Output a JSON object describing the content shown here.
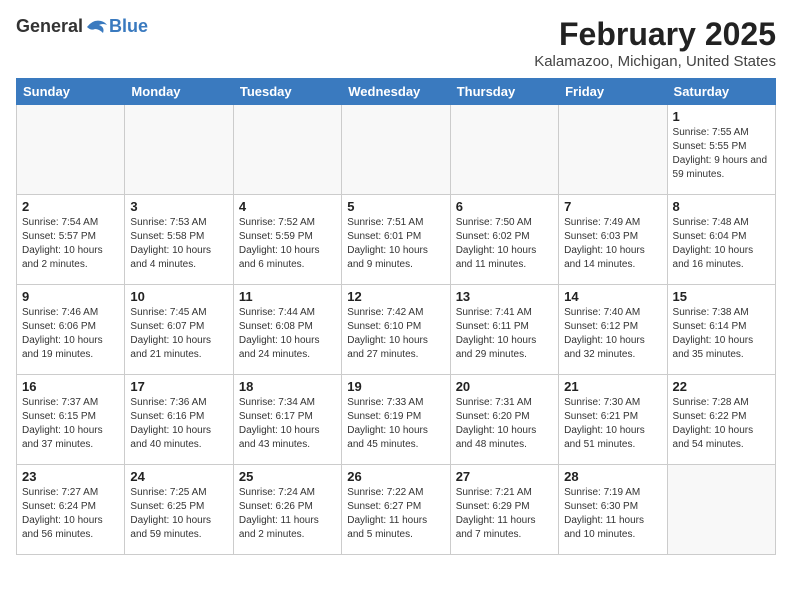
{
  "header": {
    "logo_general": "General",
    "logo_blue": "Blue",
    "title": "February 2025",
    "subtitle": "Kalamazoo, Michigan, United States"
  },
  "weekdays": [
    "Sunday",
    "Monday",
    "Tuesday",
    "Wednesday",
    "Thursday",
    "Friday",
    "Saturday"
  ],
  "weeks": [
    [
      {
        "day": "",
        "info": ""
      },
      {
        "day": "",
        "info": ""
      },
      {
        "day": "",
        "info": ""
      },
      {
        "day": "",
        "info": ""
      },
      {
        "day": "",
        "info": ""
      },
      {
        "day": "",
        "info": ""
      },
      {
        "day": "1",
        "info": "Sunrise: 7:55 AM\nSunset: 5:55 PM\nDaylight: 9 hours and 59 minutes."
      }
    ],
    [
      {
        "day": "2",
        "info": "Sunrise: 7:54 AM\nSunset: 5:57 PM\nDaylight: 10 hours and 2 minutes."
      },
      {
        "day": "3",
        "info": "Sunrise: 7:53 AM\nSunset: 5:58 PM\nDaylight: 10 hours and 4 minutes."
      },
      {
        "day": "4",
        "info": "Sunrise: 7:52 AM\nSunset: 5:59 PM\nDaylight: 10 hours and 6 minutes."
      },
      {
        "day": "5",
        "info": "Sunrise: 7:51 AM\nSunset: 6:01 PM\nDaylight: 10 hours and 9 minutes."
      },
      {
        "day": "6",
        "info": "Sunrise: 7:50 AM\nSunset: 6:02 PM\nDaylight: 10 hours and 11 minutes."
      },
      {
        "day": "7",
        "info": "Sunrise: 7:49 AM\nSunset: 6:03 PM\nDaylight: 10 hours and 14 minutes."
      },
      {
        "day": "8",
        "info": "Sunrise: 7:48 AM\nSunset: 6:04 PM\nDaylight: 10 hours and 16 minutes."
      }
    ],
    [
      {
        "day": "9",
        "info": "Sunrise: 7:46 AM\nSunset: 6:06 PM\nDaylight: 10 hours and 19 minutes."
      },
      {
        "day": "10",
        "info": "Sunrise: 7:45 AM\nSunset: 6:07 PM\nDaylight: 10 hours and 21 minutes."
      },
      {
        "day": "11",
        "info": "Sunrise: 7:44 AM\nSunset: 6:08 PM\nDaylight: 10 hours and 24 minutes."
      },
      {
        "day": "12",
        "info": "Sunrise: 7:42 AM\nSunset: 6:10 PM\nDaylight: 10 hours and 27 minutes."
      },
      {
        "day": "13",
        "info": "Sunrise: 7:41 AM\nSunset: 6:11 PM\nDaylight: 10 hours and 29 minutes."
      },
      {
        "day": "14",
        "info": "Sunrise: 7:40 AM\nSunset: 6:12 PM\nDaylight: 10 hours and 32 minutes."
      },
      {
        "day": "15",
        "info": "Sunrise: 7:38 AM\nSunset: 6:14 PM\nDaylight: 10 hours and 35 minutes."
      }
    ],
    [
      {
        "day": "16",
        "info": "Sunrise: 7:37 AM\nSunset: 6:15 PM\nDaylight: 10 hours and 37 minutes."
      },
      {
        "day": "17",
        "info": "Sunrise: 7:36 AM\nSunset: 6:16 PM\nDaylight: 10 hours and 40 minutes."
      },
      {
        "day": "18",
        "info": "Sunrise: 7:34 AM\nSunset: 6:17 PM\nDaylight: 10 hours and 43 minutes."
      },
      {
        "day": "19",
        "info": "Sunrise: 7:33 AM\nSunset: 6:19 PM\nDaylight: 10 hours and 45 minutes."
      },
      {
        "day": "20",
        "info": "Sunrise: 7:31 AM\nSunset: 6:20 PM\nDaylight: 10 hours and 48 minutes."
      },
      {
        "day": "21",
        "info": "Sunrise: 7:30 AM\nSunset: 6:21 PM\nDaylight: 10 hours and 51 minutes."
      },
      {
        "day": "22",
        "info": "Sunrise: 7:28 AM\nSunset: 6:22 PM\nDaylight: 10 hours and 54 minutes."
      }
    ],
    [
      {
        "day": "23",
        "info": "Sunrise: 7:27 AM\nSunset: 6:24 PM\nDaylight: 10 hours and 56 minutes."
      },
      {
        "day": "24",
        "info": "Sunrise: 7:25 AM\nSunset: 6:25 PM\nDaylight: 10 hours and 59 minutes."
      },
      {
        "day": "25",
        "info": "Sunrise: 7:24 AM\nSunset: 6:26 PM\nDaylight: 11 hours and 2 minutes."
      },
      {
        "day": "26",
        "info": "Sunrise: 7:22 AM\nSunset: 6:27 PM\nDaylight: 11 hours and 5 minutes."
      },
      {
        "day": "27",
        "info": "Sunrise: 7:21 AM\nSunset: 6:29 PM\nDaylight: 11 hours and 7 minutes."
      },
      {
        "day": "28",
        "info": "Sunrise: 7:19 AM\nSunset: 6:30 PM\nDaylight: 11 hours and 10 minutes."
      },
      {
        "day": "",
        "info": ""
      }
    ]
  ]
}
